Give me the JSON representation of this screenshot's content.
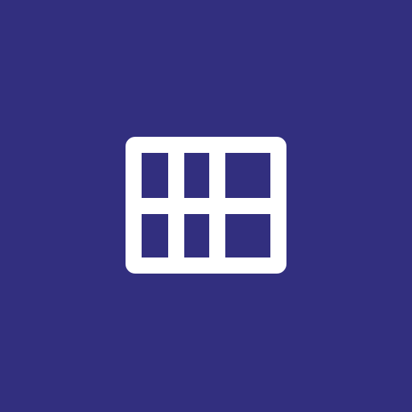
{
  "colors": {
    "background": "#322f7f",
    "icon": "#ffffff"
  },
  "icon": {
    "name": "window-grid-icon"
  }
}
